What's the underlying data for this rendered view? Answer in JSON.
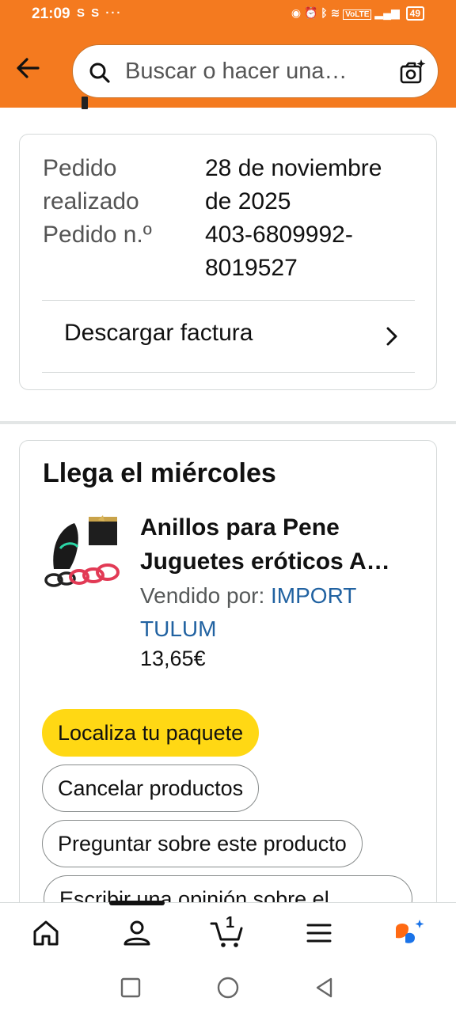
{
  "status_bar": {
    "time": "21:09",
    "notifications": "S S ···",
    "volte": "VoLTE",
    "battery": "49"
  },
  "header": {
    "search_placeholder": "Buscar o hacer una…"
  },
  "order": {
    "placed_label_line1": "Pedido",
    "placed_label_line2": "realizado",
    "placed_value_line1": "28 de noviembre",
    "placed_value_line2": "de 2025",
    "number_label": "Pedido n.º",
    "number_value_line1": "403-6809992-",
    "number_value_line2": "8019527",
    "download_invoice": "Descargar factura"
  },
  "delivery": {
    "title": "Llega el miércoles",
    "product": {
      "title_line1": "Anillos para Pene",
      "title_line2": "Juguetes eróticos A…",
      "sold_by_label": "Vendido por:",
      "seller_name": "IMPORT TULUM",
      "price": "13,65€"
    },
    "actions": {
      "track": "Localiza tu paquete",
      "cancel": "Cancelar productos",
      "ask": "Preguntar sobre este producto",
      "review": "Escribir una opinión sobre el"
    }
  },
  "bottom_nav": {
    "cart_count": "1"
  },
  "colors": {
    "brand_orange": "#f47a1f",
    "button_yellow": "#ffd814",
    "link_blue": "#2162a1",
    "alexa_orange": "#ff6a13",
    "alexa_blue": "#1a73e8"
  }
}
